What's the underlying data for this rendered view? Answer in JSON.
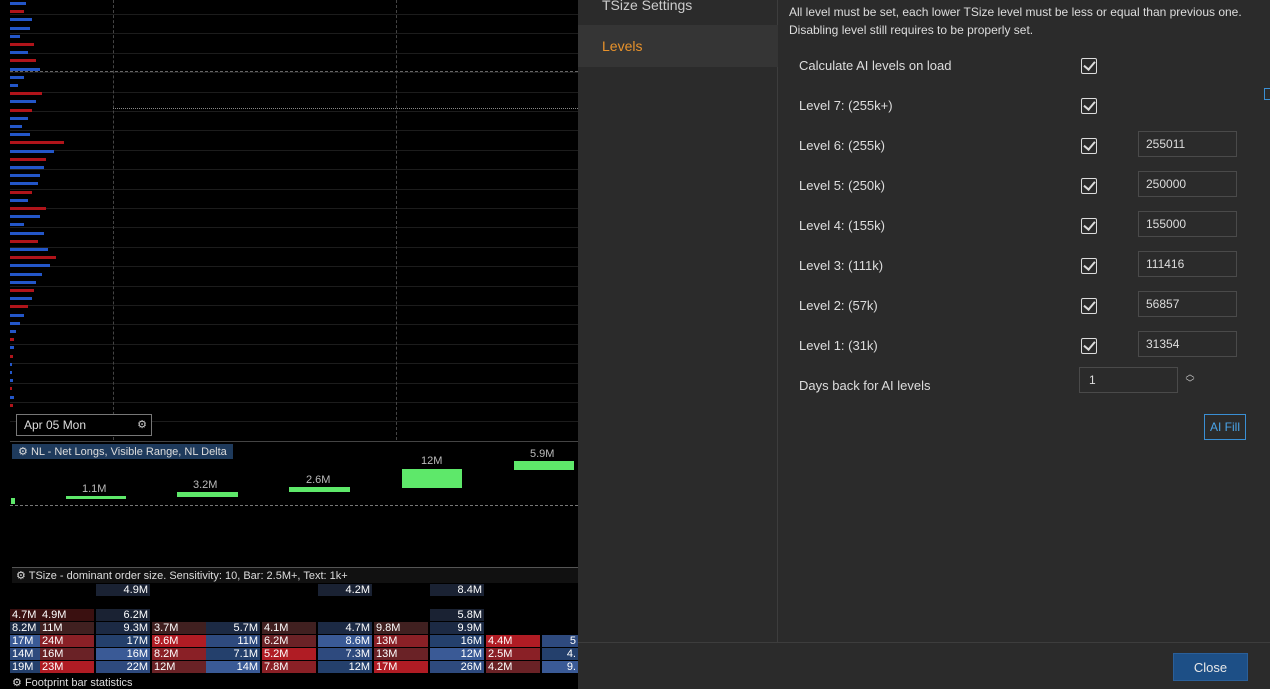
{
  "chart": {
    "date_label": "Apr 05 Mon",
    "nl_indicator_label": "NL - Net Longs, Visible Range, NL Delta",
    "nl_values": [
      "1.1M",
      "3.2M",
      "2.6M",
      "12M",
      "5.9M"
    ],
    "tsize_label": "TSize - dominant order size. Sensitivity: 10, Bar: 2.5M+, Text: 1k+",
    "footprint_label": "Footprint bar statistics",
    "footprint_rows": [
      [
        "",
        "",
        "4.9M",
        "",
        "",
        "",
        "4.2M",
        "",
        "8.4M",
        "",
        ""
      ],
      [
        "4.7M",
        "4.9M",
        "6.2M",
        "",
        "",
        "",
        "",
        "",
        "5.8M",
        "",
        ""
      ],
      [
        "8.2M",
        "11M",
        "9.3M",
        "3.7M",
        "5.7M",
        "4.1M",
        "4.7M",
        "9.8M",
        "9.9M",
        "",
        ""
      ],
      [
        "17M",
        "24M",
        "17M",
        "9.6M",
        "11M",
        "6.2M",
        "8.6M",
        "13M",
        "16M",
        "4.4M",
        "5"
      ],
      [
        "14M",
        "16M",
        "16M",
        "8.2M",
        "7.1M",
        "5.2M",
        "7.3M",
        "13M",
        "12M",
        "2.5M",
        "4."
      ],
      [
        "19M",
        "23M",
        "22M",
        "12M",
        "14M",
        "7.8M",
        "12M",
        "17M",
        "26M",
        "4.2M",
        "9."
      ]
    ]
  },
  "dialog": {
    "nav": {
      "tsize_settings": "TSize Settings",
      "levels": "Levels"
    },
    "info_text": "All level must be set, each lower TSize level must be less or equal than previous one. Disabling level still requires to be properly set.",
    "rows": [
      {
        "label": "Calculate AI levels on load",
        "checked": true,
        "value": ""
      },
      {
        "label": "Level 7: (255k+)",
        "checked": true,
        "value": ""
      },
      {
        "label": "Level 6: (255k)",
        "checked": true,
        "value": "255011"
      },
      {
        "label": "Level 5: (250k)",
        "checked": true,
        "value": "250000"
      },
      {
        "label": "Level 4: (155k)",
        "checked": true,
        "value": "155000"
      },
      {
        "label": "Level 3: (111k)",
        "checked": true,
        "value": "111416"
      },
      {
        "label": "Level 2: (57k)",
        "checked": true,
        "value": "56857"
      },
      {
        "label": "Level 1: (31k)",
        "checked": true,
        "value": "31354"
      }
    ],
    "days_back_label": "Days back for AI levels",
    "days_back_value": "1",
    "ai_fill_label": "AI Fill",
    "close_label": "Close"
  },
  "colors": {
    "accent_orange": "#e8922b",
    "accent_blue": "#3a8fd4",
    "bid_red": "#b0141a",
    "ask_blue": "#2356c8",
    "nl_green": "#5ee86a"
  }
}
